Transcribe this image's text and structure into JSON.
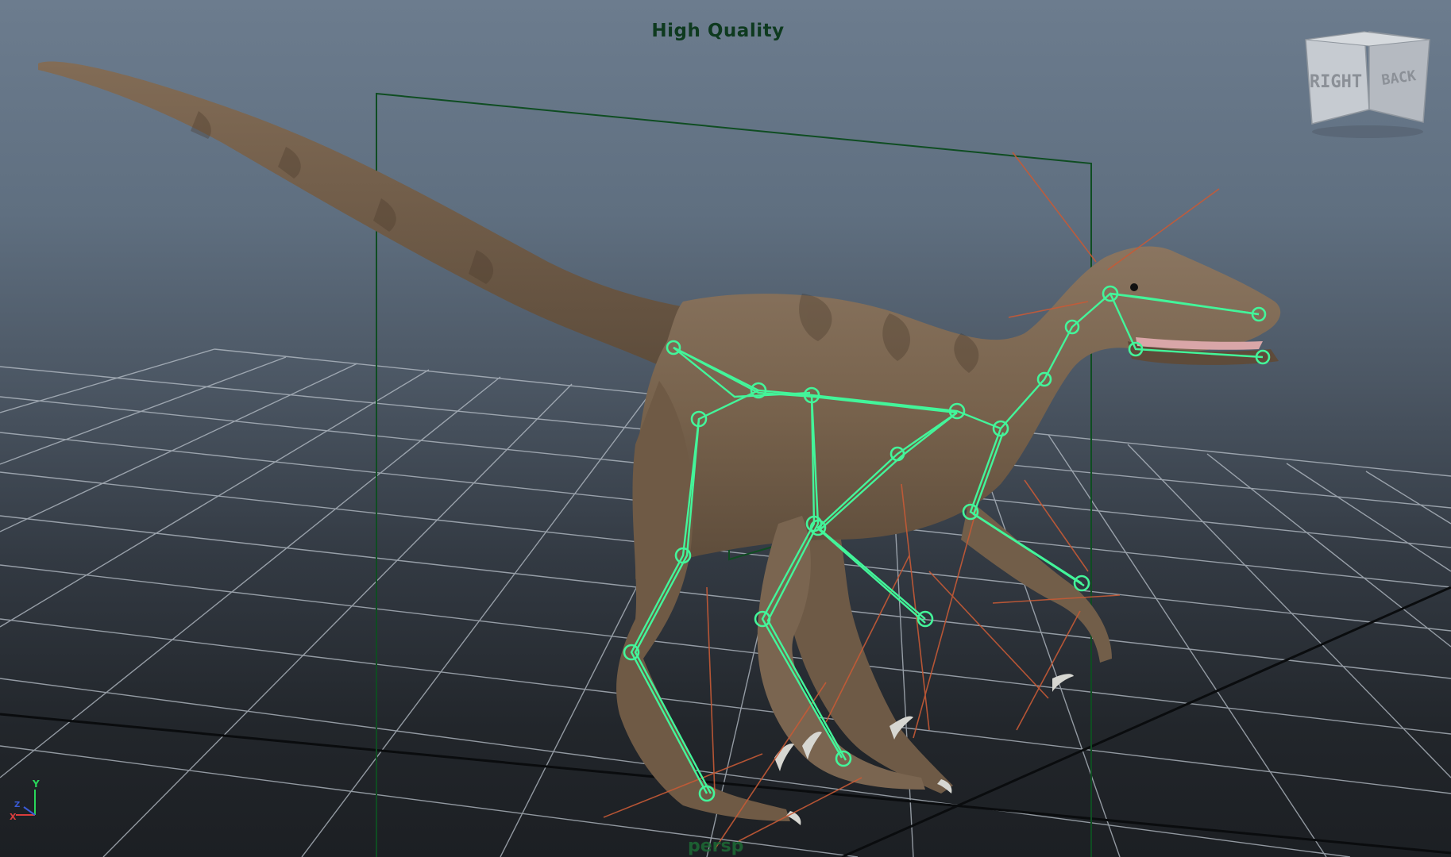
{
  "viewport": {
    "hud_title": "High Quality",
    "camera_name": "persp"
  },
  "view_cube": {
    "right_label": "RIGHT",
    "back_label": "BACK"
  },
  "axis_gizmo": {
    "y_label": "Y",
    "z_label": "Z",
    "x_label": "X"
  },
  "colors": {
    "joint_highlight": "#43f59a",
    "ik_lines": "#c65a36",
    "bounding_box": "#0f4d22",
    "grid": "#b9c1ca",
    "skin": "#7b6650"
  }
}
